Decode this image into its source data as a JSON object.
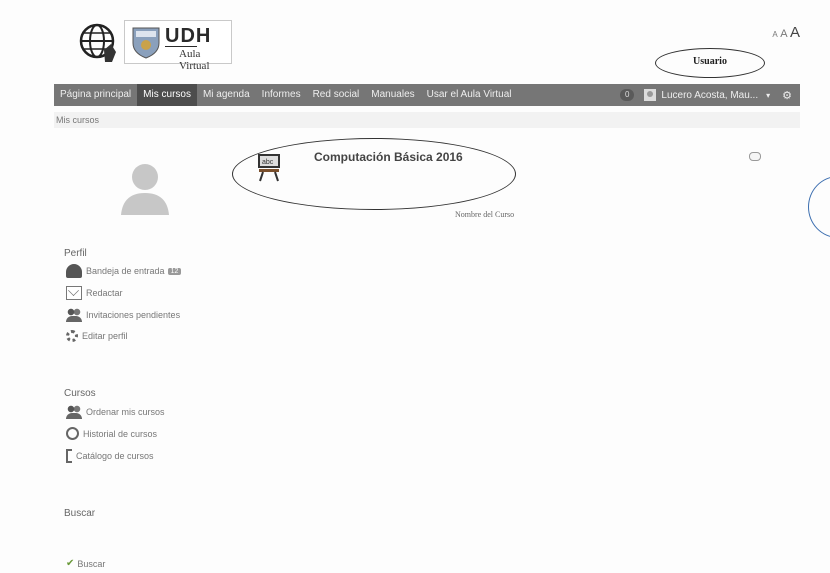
{
  "header": {
    "logo_text": "UDH",
    "logo_subtitle": "Aula Virtual",
    "font_size_small": "A",
    "font_size_medium": "A",
    "font_size_large": "A"
  },
  "annotations": {
    "user_label": "Usuario",
    "course_caption": "Nombre del Curso"
  },
  "nav": {
    "items": [
      {
        "label": "Página principal"
      },
      {
        "label": "Mis cursos"
      },
      {
        "label": "Mi agenda"
      },
      {
        "label": "Informes"
      },
      {
        "label": "Red social"
      },
      {
        "label": "Manuales"
      },
      {
        "label": "Usar el Aula Virtual"
      }
    ],
    "active_index": 1,
    "badge": "0",
    "user_name": "Lucero Acosta, Mau..."
  },
  "breadcrumb": "Mis cursos",
  "sidebar": {
    "profile": {
      "title": "Perfil",
      "items": [
        {
          "label": "Bandeja de entrada",
          "icon": "inbox-icon",
          "count": "12"
        },
        {
          "label": "Redactar",
          "icon": "compose-icon"
        },
        {
          "label": "Invitaciones pendientes",
          "icon": "invitations-icon"
        },
        {
          "label": "Editar perfil",
          "icon": "edit-profile-icon"
        }
      ]
    },
    "courses": {
      "title": "Cursos",
      "items": [
        {
          "label": "Ordenar mis cursos",
          "icon": "sort-courses-icon"
        },
        {
          "label": "Historial de cursos",
          "icon": "history-icon"
        },
        {
          "label": "Catálogo de cursos",
          "icon": "catalog-icon"
        }
      ]
    },
    "search": {
      "title": "Buscar",
      "button": "Buscar"
    }
  },
  "course": {
    "title": "Computación Básica 2016"
  }
}
